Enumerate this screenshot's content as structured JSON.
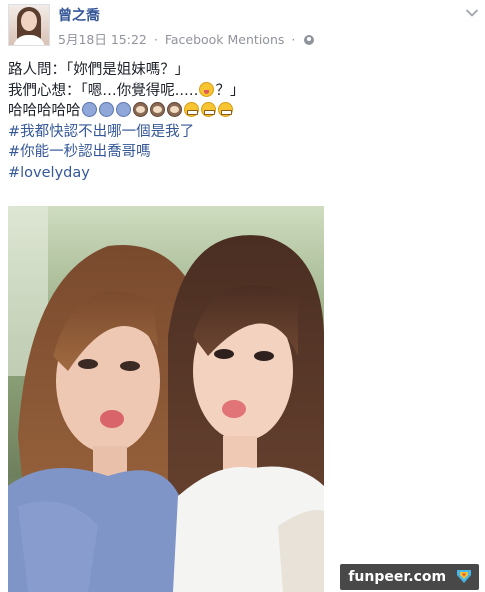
{
  "post": {
    "author_name": "曾之喬",
    "date": "5月18日 15:22",
    "separator": "·",
    "source": "Facebook Mentions",
    "audience_icon": "globe-icon",
    "options_icon": "chevron-down-icon"
  },
  "content": {
    "line1": "路人問：「妳們是姐妹嗎？」",
    "line2_before": "我們心想：「嗯…你覺得呢..…",
    "line2_after": "？」",
    "line3_text": "哈哈哈哈哈",
    "hashtags": [
      "#我都快認不出哪一個是我了",
      "#你能一秒認出喬哥嗎",
      "#lovelyday"
    ]
  },
  "photo": {
    "alt": "selfie of two women"
  },
  "watermark": {
    "text": "funpeer.com"
  },
  "colors": {
    "link": "#365899",
    "meta": "#90949c",
    "text": "#1d2129"
  }
}
